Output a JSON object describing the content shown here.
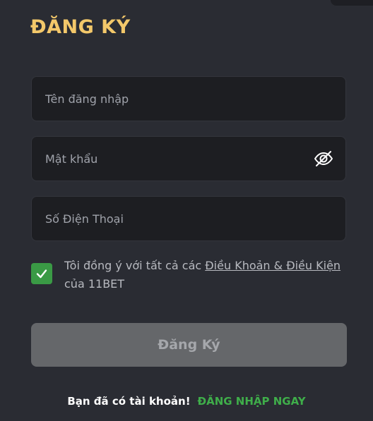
{
  "form": {
    "title": "ĐĂNG KÝ",
    "username_placeholder": "Tên đăng nhập",
    "password_placeholder": "Mật khẩu",
    "phone_placeholder": "Số Điện Thoại",
    "password_toggle_icon": "eye-slash-icon",
    "terms": {
      "checked": true,
      "prefix": "Tôi đồng ý với tất cả các ",
      "link_label": "Điều Khoản & Điều Kiện",
      "suffix": " của 11BET"
    },
    "submit_label": "Đăng Ký",
    "login_prompt": "Bạn đã có tài khoản!",
    "login_link_label": "ĐĂNG NHẬP NGAY"
  },
  "colors": {
    "panel_bg": "#2a2c33",
    "title": "#f3c86a",
    "checkbox": "#3a9a45",
    "button_disabled": "#65676a",
    "login_link": "#3fae4a"
  }
}
